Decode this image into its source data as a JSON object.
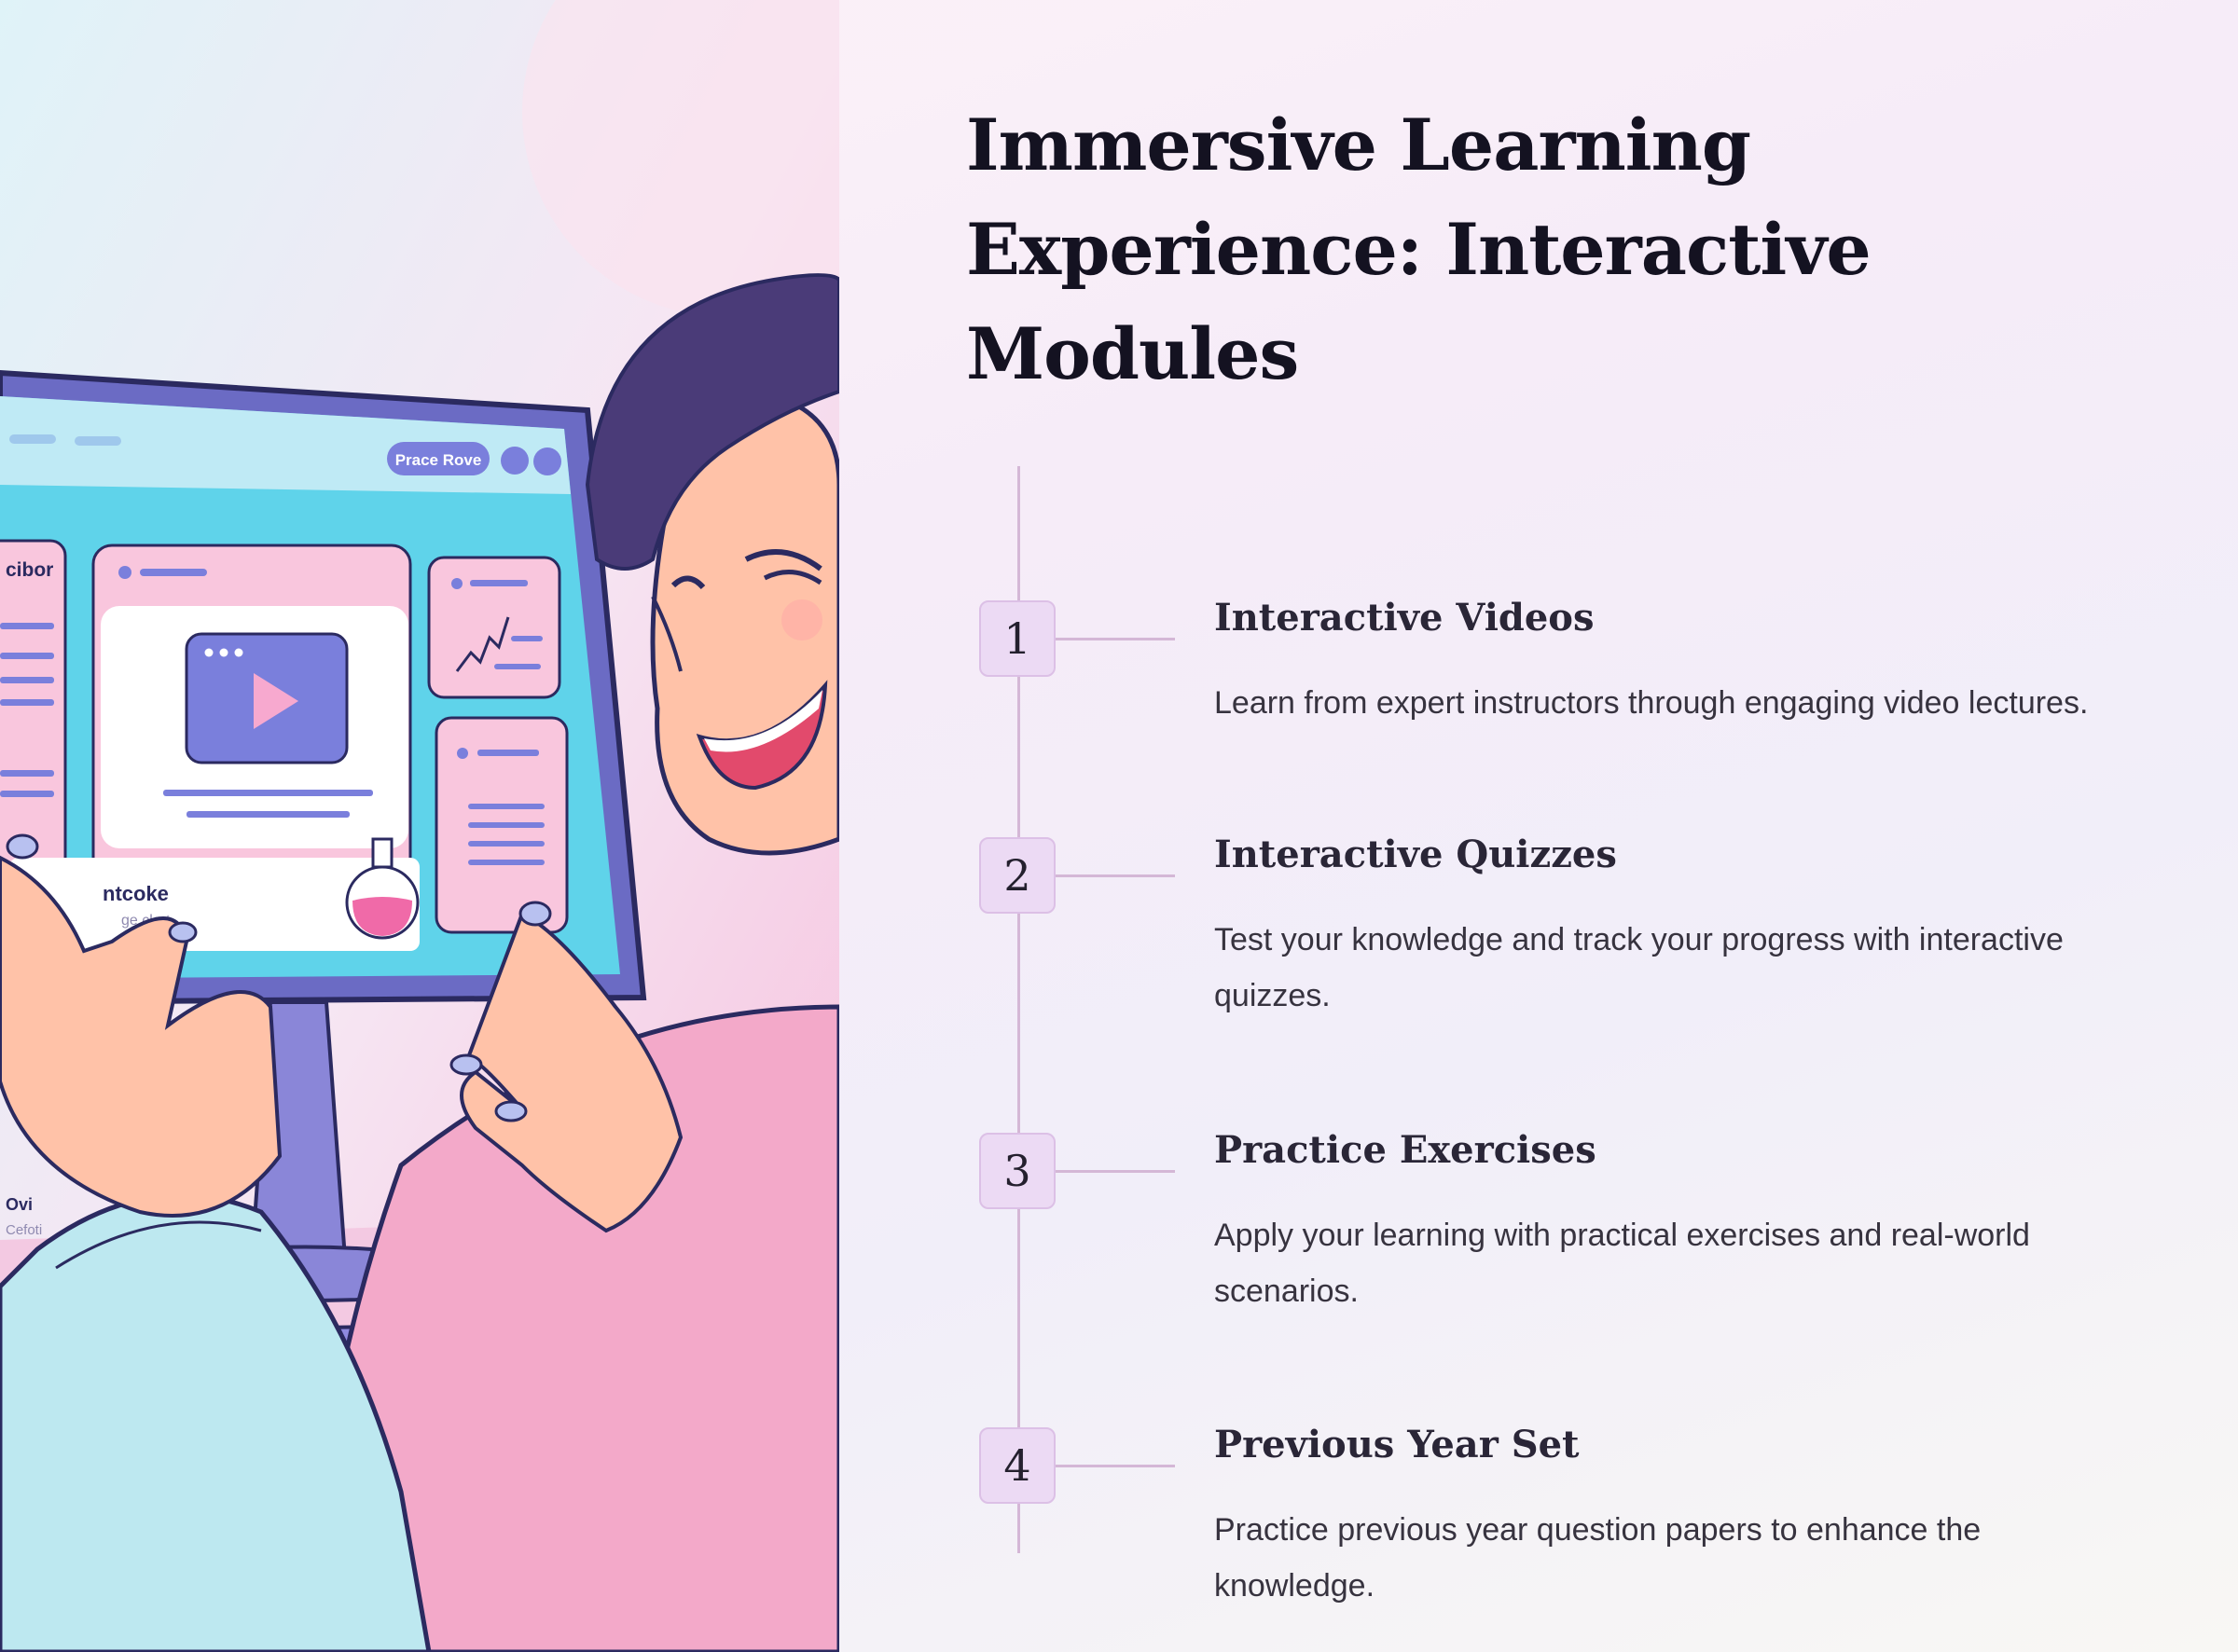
{
  "title": "Immersive Learning Experience: Interactive Modules",
  "illustration": {
    "screen_button": "Prace Rove",
    "side_label": "cibor",
    "card_title": "ntcoke",
    "card_subtitle": "ge clart",
    "desk_label": "Ovi",
    "desk_sub": "Cefoti",
    "icons": [
      "play-icon",
      "chart-icon",
      "flask-icon"
    ]
  },
  "steps": [
    {
      "number": "1",
      "title": "Interactive Videos",
      "description": "Learn from expert instructors through engaging video lectures."
    },
    {
      "number": "2",
      "title": "Interactive Quizzes",
      "description": "Test your knowledge and track your progress with interactive quizzes."
    },
    {
      "number": "3",
      "title": "Practice Exercises",
      "description": "Apply your learning with practical exercises and real-world scenarios."
    },
    {
      "number": "4",
      "title": "Previous Year Set",
      "description": "Practice previous year question papers to enhance the knowledge."
    }
  ],
  "colors": {
    "title": "#141221",
    "badge_fill": "#ecdaf4",
    "timeline": "#d4b7d6",
    "screen": "#5fd3ea",
    "accent_purple": "#7a7fdc",
    "sweater": "#f3a9c9"
  }
}
